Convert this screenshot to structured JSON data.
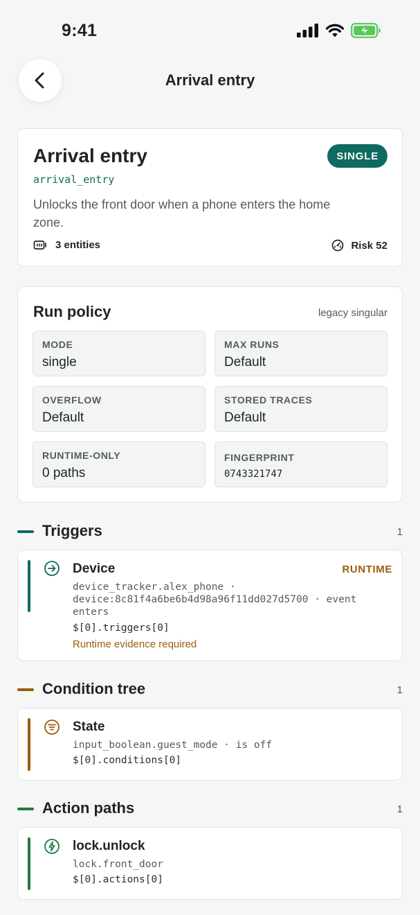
{
  "status_bar": {
    "time": "9:41"
  },
  "nav": {
    "title": "Arrival entry"
  },
  "summary": {
    "title": "Arrival entry",
    "mode_badge": "SINGLE",
    "id": "arrival_entry",
    "description": "Unlocks the front door when a phone enters the home zone.",
    "entities": "3 entities",
    "risk": "Risk 52"
  },
  "run_policy": {
    "title": "Run policy",
    "note": "legacy singular",
    "tiles": [
      {
        "label": "MODE",
        "value": "single"
      },
      {
        "label": "MAX RUNS",
        "value": "Default"
      },
      {
        "label": "OVERFLOW",
        "value": "Default"
      },
      {
        "label": "STORED TRACES",
        "value": "Default"
      },
      {
        "label": "RUNTIME-ONLY",
        "value": "0 paths"
      },
      {
        "label": "FINGERPRINT",
        "value": "0743321747"
      }
    ]
  },
  "triggers": {
    "title": "Triggers",
    "count": "1",
    "items": [
      {
        "name": "Device",
        "badge": "RUNTIME",
        "detail_1": "device_tracker.alex_phone ·",
        "detail_2": "device:8c81f4a6be6b4d98a96f11dd027d5700 · event",
        "detail_3": "enters",
        "path": "$[0].triggers[0]",
        "evidence": "Runtime evidence required"
      }
    ]
  },
  "conditions": {
    "title": "Condition tree",
    "count": "1",
    "items": [
      {
        "name": "State",
        "detail": "input_boolean.guest_mode · is off",
        "path": "$[0].conditions[0]"
      }
    ]
  },
  "actions": {
    "title": "Action paths",
    "count": "1",
    "items": [
      {
        "name": "lock.unlock",
        "detail": "lock.front_door",
        "path": "$[0].actions[0]"
      }
    ]
  },
  "colors": {
    "teal": "#0e6b5f",
    "amber": "#9a5e0a",
    "green": "#1f7a43"
  },
  "icons": {
    "back": "chevron-left-icon",
    "entities": "device-icon",
    "risk": "gauge-icon",
    "trigger": "arrow-circle-icon",
    "condition": "filter-list-icon",
    "action": "lightning-icon"
  }
}
